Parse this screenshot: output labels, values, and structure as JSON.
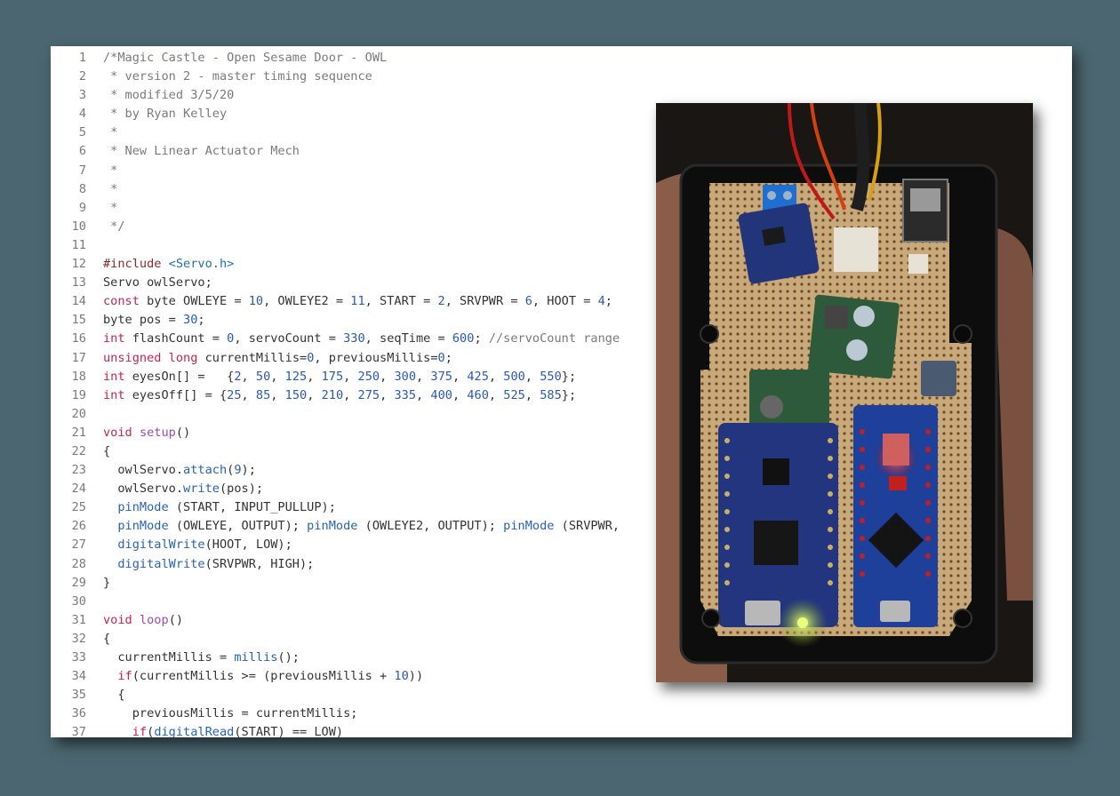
{
  "code_lines": [
    {
      "n": "1",
      "html": "<span class=\"com\">/*Magic Castle - Open Sesame Door - OWL</span>"
    },
    {
      "n": "2",
      "html": "<span class=\"com\"> * version 2 - master timing sequence</span>"
    },
    {
      "n": "3",
      "html": "<span class=\"com\"> * modified 3/5/20</span>"
    },
    {
      "n": "4",
      "html": "<span class=\"com\"> * by Ryan Kelley</span>"
    },
    {
      "n": "5",
      "html": "<span class=\"com\"> *</span>"
    },
    {
      "n": "6",
      "html": "<span class=\"com\"> * New Linear Actuator Mech</span>"
    },
    {
      "n": "7",
      "html": "<span class=\"com\"> *</span>"
    },
    {
      "n": "8",
      "html": "<span class=\"com\"> *</span>"
    },
    {
      "n": "9",
      "html": "<span class=\"com\"> *</span>"
    },
    {
      "n": "10",
      "html": "<span class=\"com\"> */</span>"
    },
    {
      "n": "11",
      "html": ""
    },
    {
      "n": "12",
      "html": "<span class=\"pp\">#include</span> <span class=\"hdr\">&lt;Servo.h&gt;</span>"
    },
    {
      "n": "13",
      "html": "Servo owlServo;"
    },
    {
      "n": "14",
      "html": "<span class=\"kw\">const</span> byte OWLEYE = <span class=\"num\">10</span>, OWLEYE2 = <span class=\"num\">11</span>, START = <span class=\"num\">2</span>, SRVPWR = <span class=\"num\">6</span>, HOOT = <span class=\"num\">4</span>;"
    },
    {
      "n": "15",
      "html": "byte pos = <span class=\"num\">30</span>;"
    },
    {
      "n": "16",
      "html": "<span class=\"kw\">int</span> flashCount = <span class=\"num\">0</span>, servoCount = <span class=\"num\">330</span>, seqTime = <span class=\"num\">600</span>; <span class=\"com\">//servoCount range</span>"
    },
    {
      "n": "17",
      "html": "<span class=\"kw\">unsigned</span> <span class=\"kw\">long</span> currentMillis=<span class=\"num\">0</span>, previousMillis=<span class=\"num\">0</span>;"
    },
    {
      "n": "18",
      "html": "<span class=\"kw\">int</span> eyesOn[] =   {<span class=\"num\">2</span>, <span class=\"num\">50</span>, <span class=\"num\">125</span>, <span class=\"num\">175</span>, <span class=\"num\">250</span>, <span class=\"num\">300</span>, <span class=\"num\">375</span>, <span class=\"num\">425</span>, <span class=\"num\">500</span>, <span class=\"num\">550</span>};"
    },
    {
      "n": "19",
      "html": "<span class=\"kw\">int</span> eyesOff[] = {<span class=\"num\">25</span>, <span class=\"num\">85</span>, <span class=\"num\">150</span>, <span class=\"num\">210</span>, <span class=\"num\">275</span>, <span class=\"num\">335</span>, <span class=\"num\">400</span>, <span class=\"num\">460</span>, <span class=\"num\">525</span>, <span class=\"num\">585</span>};"
    },
    {
      "n": "20",
      "html": ""
    },
    {
      "n": "21",
      "html": "<span class=\"kw\">void</span> <span class=\"kf\">setup</span>()"
    },
    {
      "n": "22",
      "html": "{"
    },
    {
      "n": "23",
      "html": "  owlServo.<span class=\"fn\">attach</span>(<span class=\"num\">9</span>);"
    },
    {
      "n": "24",
      "html": "  owlServo.<span class=\"fn\">write</span>(pos);"
    },
    {
      "n": "25",
      "html": "  <span class=\"fn\">pinMode</span> (START, INPUT_PULLUP);"
    },
    {
      "n": "26",
      "html": "  <span class=\"fn\">pinMode</span> (OWLEYE, OUTPUT); <span class=\"fn\">pinMode</span> (OWLEYE2, OUTPUT); <span class=\"fn\">pinMode</span> (SRVPWR,"
    },
    {
      "n": "27",
      "html": "  <span class=\"fn\">digitalWrite</span>(HOOT, LOW);"
    },
    {
      "n": "28",
      "html": "  <span class=\"fn\">digitalWrite</span>(SRVPWR, HIGH);"
    },
    {
      "n": "29",
      "html": "}"
    },
    {
      "n": "30",
      "html": ""
    },
    {
      "n": "31",
      "html": "<span class=\"kw\">void</span> <span class=\"kf\">loop</span>()"
    },
    {
      "n": "32",
      "html": "{"
    },
    {
      "n": "33",
      "html": "  currentMillis = <span class=\"fn\">millis</span>();"
    },
    {
      "n": "34",
      "html": "  <span class=\"kw\">if</span>(currentMillis &gt;= (previousMillis + <span class=\"num\">10</span>))"
    },
    {
      "n": "35",
      "html": "  {"
    },
    {
      "n": "36",
      "html": "    previousMillis = currentMillis;"
    },
    {
      "n": "37",
      "html": "    <span class=\"kw\">if</span>(<span class=\"fn\">digitalRead</span>(START) == LOW)"
    }
  ],
  "colors": {
    "background": "#4b6670",
    "keyword": "#c7254e",
    "function": "#2862b8",
    "comment": "#7a7a7a"
  }
}
